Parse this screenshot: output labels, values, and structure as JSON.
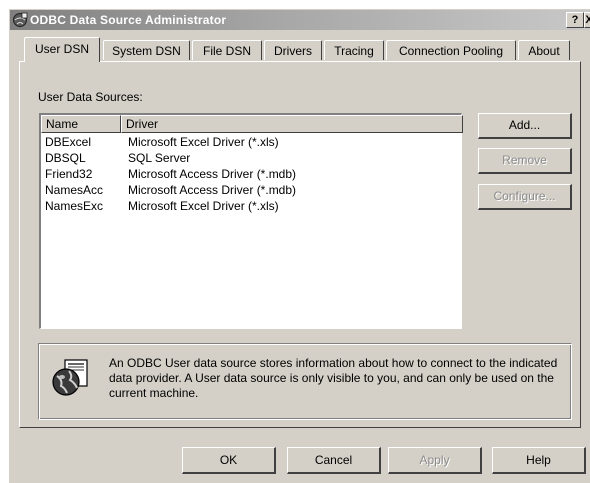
{
  "window": {
    "title": "ODBC Data Source Administrator",
    "help_glyph": "?",
    "close_glyph": "X"
  },
  "tabs": [
    {
      "label": "User DSN",
      "active": true
    },
    {
      "label": "System DSN",
      "active": false
    },
    {
      "label": "File DSN",
      "active": false
    },
    {
      "label": "Drivers",
      "active": false
    },
    {
      "label": "Tracing",
      "active": false
    },
    {
      "label": "Connection Pooling",
      "active": false
    },
    {
      "label": "About",
      "active": false
    }
  ],
  "sources": {
    "label": "User Data Sources:",
    "columns": [
      "Name",
      "Driver"
    ],
    "rows": [
      {
        "name": "DBExcel",
        "driver": "Microsoft Excel Driver (*.xls)"
      },
      {
        "name": "DBSQL",
        "driver": "SQL Server"
      },
      {
        "name": "Friend32",
        "driver": "Microsoft Access Driver (*.mdb)"
      },
      {
        "name": "NamesAcc",
        "driver": "Microsoft Access Driver (*.mdb)"
      },
      {
        "name": "NamesExc",
        "driver": "Microsoft Excel Driver (*.xls)"
      }
    ]
  },
  "actions": {
    "add": "Add...",
    "remove": "Remove",
    "configure": "Configure..."
  },
  "info": {
    "icon": "odbc-globe-icon",
    "text": "An ODBC User data source stores information about how to connect to the indicated data provider.  A User data source is only visible to you, and can only be used on the current machine."
  },
  "footer": {
    "ok": "OK",
    "cancel": "Cancel",
    "apply": "Apply",
    "help": "Help"
  }
}
